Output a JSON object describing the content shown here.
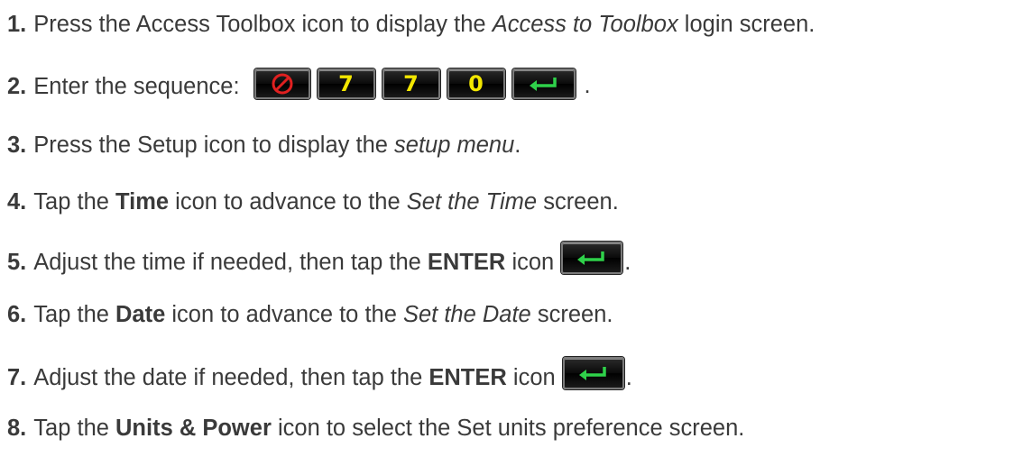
{
  "steps": [
    {
      "num": "1.",
      "a": "Press the Access Toolbox icon to display the ",
      "i": "Access to Toolbox",
      "b": " login screen."
    },
    {
      "num": "2.",
      "a": "Enter the sequence:",
      "keys": [
        "7",
        "7",
        "0"
      ],
      "end": "."
    },
    {
      "num": "3.",
      "a": "Press the Setup icon to display the ",
      "i": "setup menu",
      "b": "."
    },
    {
      "num": "4.",
      "a": "Tap the ",
      "bold": "Time",
      "c": " icon to advance to the ",
      "i": "Set the Time",
      "b": " screen."
    },
    {
      "num": "5.",
      "a": "Adjust the time if needed, then tap the ",
      "bold": "ENTER",
      "c": " icon",
      "end": "."
    },
    {
      "num": "6.",
      "a": "Tap the ",
      "bold": "Date",
      "c": " icon to advance to the ",
      "i": "Set the Date",
      "b": " screen."
    },
    {
      "num": "7.",
      "a": "Adjust the date if needed, then tap the ",
      "bold": "ENTER",
      "c": " icon",
      "end": "."
    },
    {
      "num": "8.",
      "a": "Tap the ",
      "bold": "Units & Power",
      "c": " icon to select the Set units preference screen."
    }
  ],
  "icons": {
    "cancel": "cancel-icon",
    "enter": "enter-icon"
  },
  "colors": {
    "text": "#3a3a3a",
    "key_digit": "#f2e600",
    "cancel_red": "#e02020",
    "enter_green": "#2fd14a"
  }
}
